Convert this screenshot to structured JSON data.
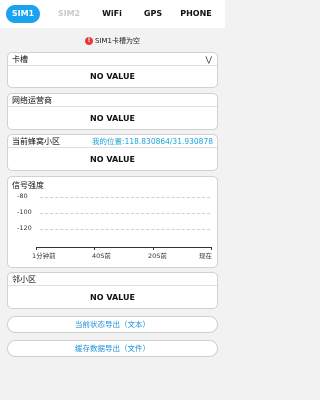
{
  "tabs": [
    {
      "label": "SIM1",
      "state": "active"
    },
    {
      "label": "SIM2",
      "state": "disabled"
    },
    {
      "label": "WiFi",
      "state": "normal"
    },
    {
      "label": "GPS",
      "state": "normal"
    },
    {
      "label": "PHONE",
      "state": "normal"
    }
  ],
  "warning": {
    "icon": "exclamation-icon",
    "text": "SIM1卡槽为空"
  },
  "sections": {
    "slot": {
      "title": "卡槽",
      "value": "NO VALUE"
    },
    "operator": {
      "title": "网络运营商",
      "value": "NO VALUE"
    },
    "cell": {
      "title": "当前蜂窝小区",
      "location": "我的位置:118.830864/31.930878",
      "value": "NO VALUE"
    },
    "neighbor": {
      "title": "邻小区",
      "value": "NO VALUE"
    }
  },
  "chart_data": {
    "type": "line",
    "title": "信号强度",
    "y_ticks": [
      "-80",
      "-100",
      "-120"
    ],
    "x_ticks": [
      "1分钟前",
      "40S前",
      "20S前",
      "现在"
    ],
    "ylim": [
      -130,
      -70
    ],
    "series": [],
    "grid": true
  },
  "buttons": {
    "export_status": "当前状态导出（文本）",
    "export_cache": "缓存数据导出（文件）"
  },
  "colors": {
    "accent": "#1aa3ef",
    "link": "#19a3d8",
    "warning": "#e53935"
  }
}
